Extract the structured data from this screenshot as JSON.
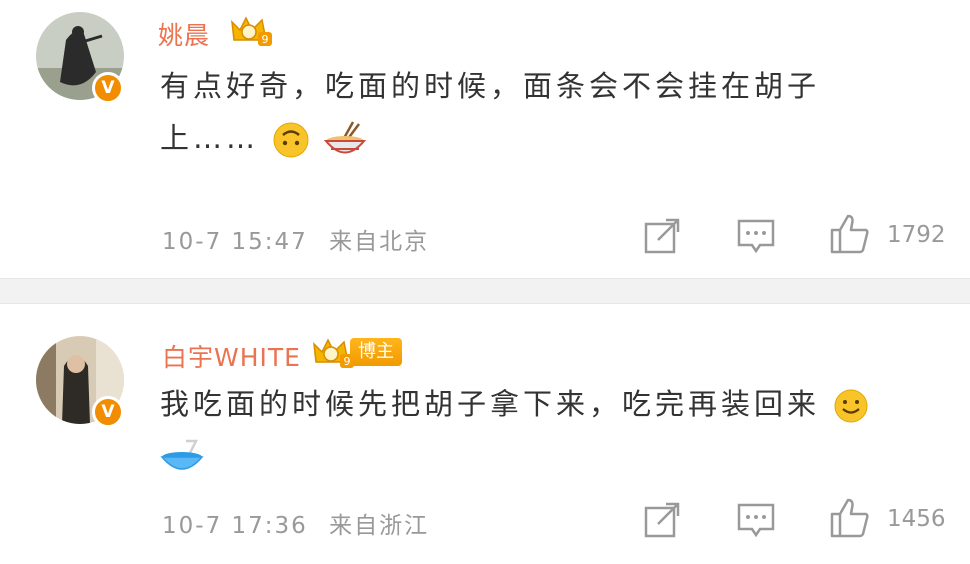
{
  "comments": [
    {
      "username": "姚晨",
      "level_icon": "level-9-crown-icon",
      "text_line1": "有点好奇，吃面的时候，面条会不会挂在胡子",
      "text_line2": "上……",
      "emojis": [
        "upside-down-face-emoji",
        "noodle-bowl-emoji"
      ],
      "time": "10-7 15:47",
      "source": "来自北京",
      "likes": "1792",
      "verified_badge": "V"
    },
    {
      "username": "白宇WHITE",
      "level_icon": "level-9-crown-icon",
      "tag": "博主",
      "text_line1": "我吃面的时候先把胡子拿下来，吃完再装回来",
      "emojis": [
        "smile-emoji",
        "bowl-emoji"
      ],
      "time": "10-7 17:36",
      "source": "来自浙江",
      "likes": "1456",
      "verified_badge": "V"
    }
  ],
  "colors": {
    "username": "#eb7350",
    "meta": "#999999",
    "text": "#333333",
    "badge": "#f28c00"
  }
}
